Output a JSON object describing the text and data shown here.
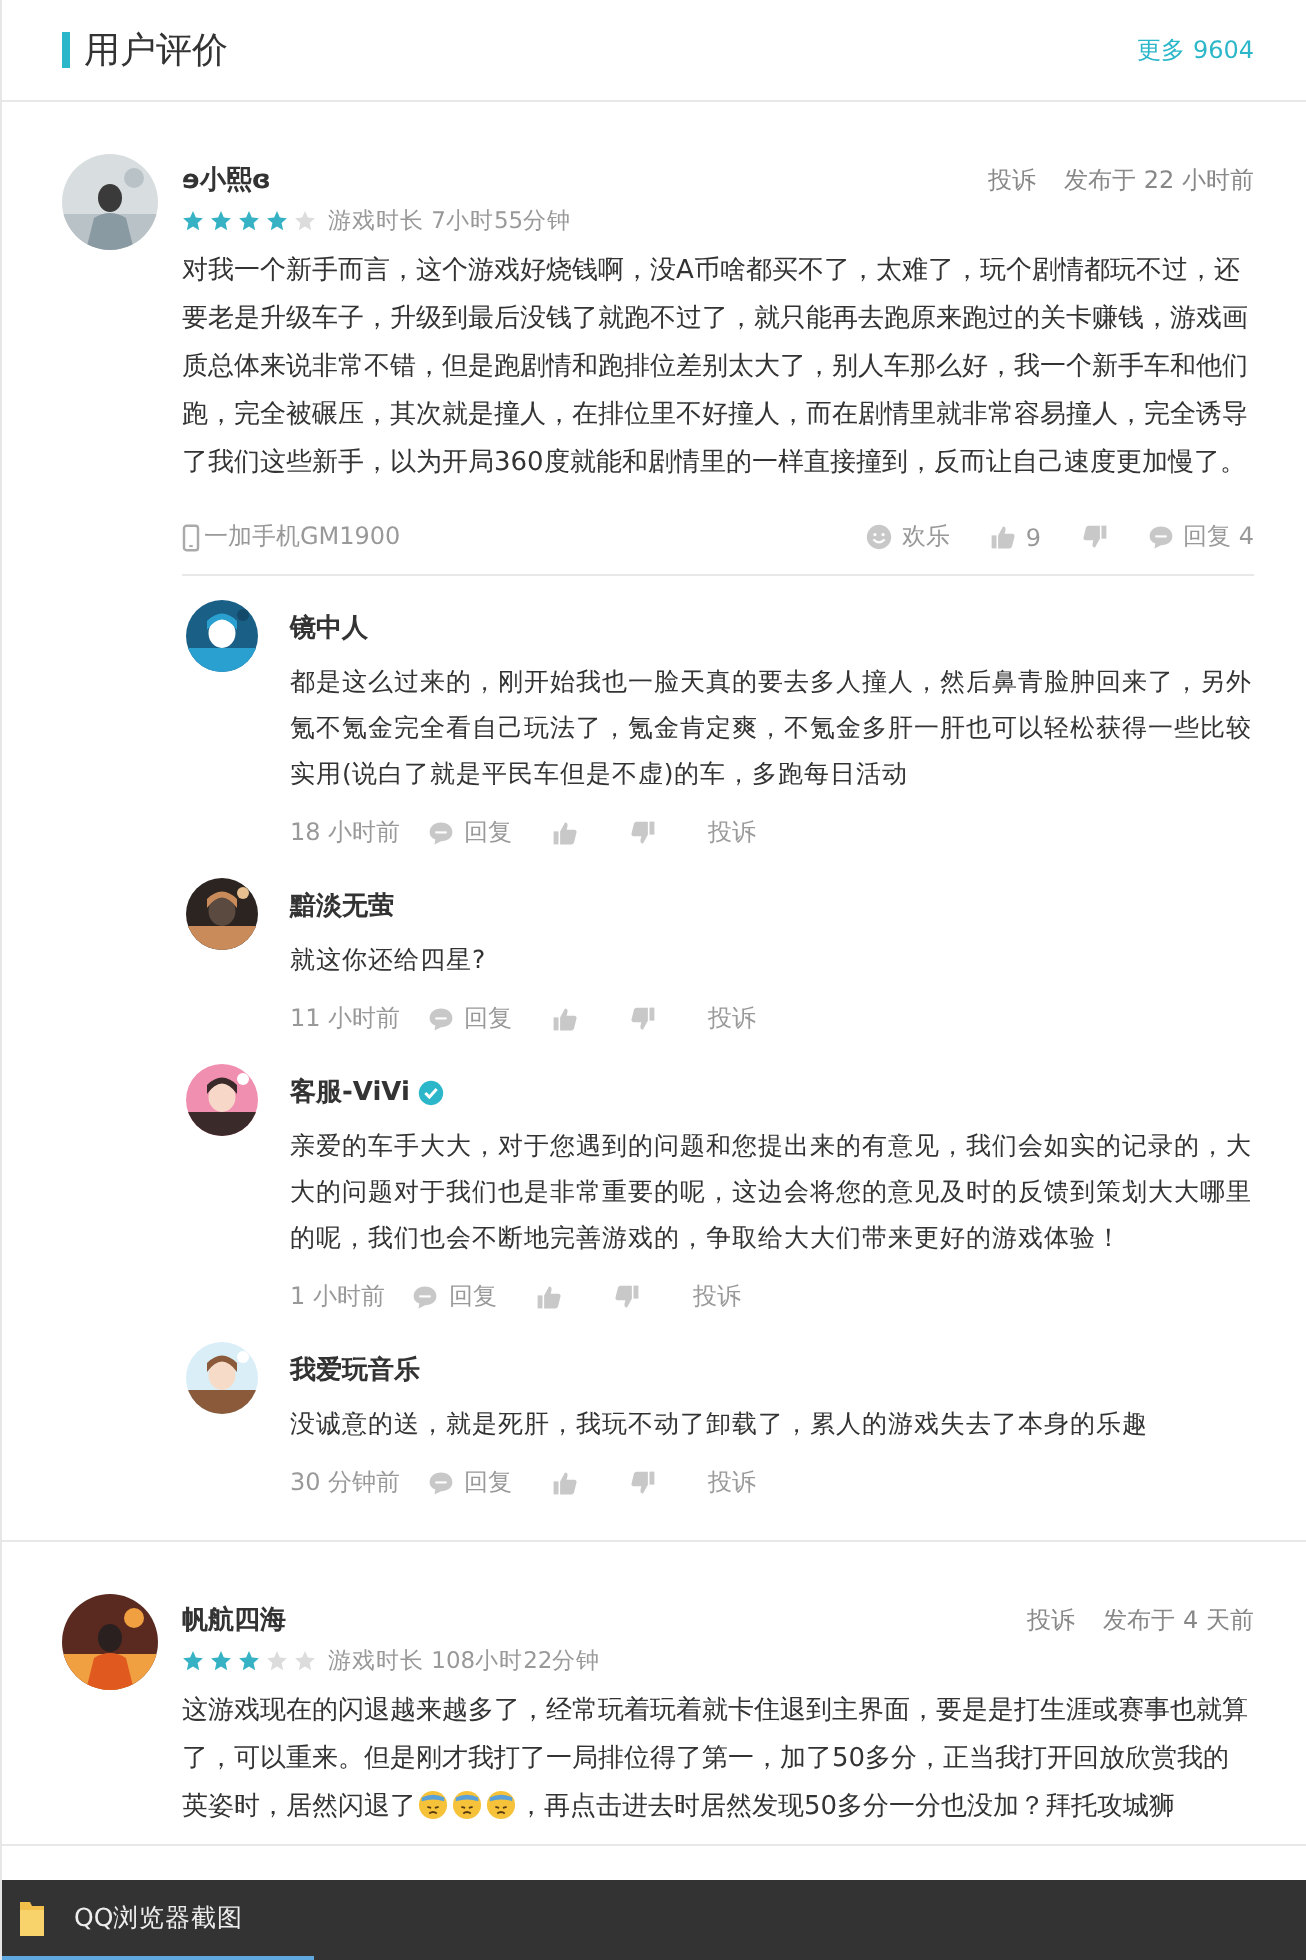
{
  "header": {
    "title": "用户评价",
    "more": "更多 9604"
  },
  "reviews": [
    {
      "name": "ɘ小熙ɞ",
      "stars": 4,
      "playtime": "游戏时长 7小时55分钟",
      "report": "投诉",
      "posted": "发布于 22 小时前",
      "body": [
        {
          "kind": "text",
          "text": "对我一个新手而言，这个游戏好烧钱啊，没A币啥都买不了，太难了，玩个剧情都玩不过，还要老是升级车子，升级到最后没钱了就跑不过了，就只能再去跑原来跑过的关卡赚钱，游戏画质总体来说非常不错，但是跑剧情和跑排位差别太大了，别人车那么好，我一个新手车和他们跑，完全被碾压，其次就是撞人，在排位里不好撞人，而在剧情里就非常容易撞人，完全诱导了我们这些新手，以为开局360度就能和剧情里的一样直接撞到，反而让自己速度更加慢了。"
        }
      ],
      "device": "一加手机GM1900",
      "mood": "欢乐",
      "likes": "9",
      "replies_label": "回复 4",
      "replies": [
        {
          "name": "镜中人",
          "verified": false,
          "text": "都是这么过来的，刚开始我也一脸天真的要去多人撞人，然后鼻青脸肿回来了，另外氪不氪金完全看自己玩法了，氪金肯定爽，不氪金多肝一肝也可以轻松获得一些比较实用(说白了就是平民车但是不虚)的车，多跑每日活动",
          "time": "18 小时前",
          "reply": "回复",
          "report": "投诉"
        },
        {
          "name": "黯淡无萤",
          "verified": false,
          "text": "就这你还给四星?",
          "time": "11 小时前",
          "reply": "回复",
          "report": "投诉"
        },
        {
          "name": "客服-ViVi",
          "verified": true,
          "text": "亲爱的车手大大，对于您遇到的问题和您提出来的有意见，我们会如实的记录的，大大的问题对于我们也是非常重要的呢，这边会将您的意见及时的反馈到策划大大哪里的呢，我们也会不断地完善游戏的，争取给大大们带来更好的游戏体验！",
          "time": "1 小时前",
          "reply": "回复",
          "report": "投诉"
        },
        {
          "name": "我爱玩音乐",
          "verified": false,
          "text": "没诚意的送，就是死肝，我玩不动了卸载了，累人的游戏失去了本身的乐趣",
          "time": "30 分钟前",
          "reply": "回复",
          "report": "投诉"
        }
      ]
    },
    {
      "name": "帆航四海",
      "stars": 3,
      "playtime": "游戏时长 108小时22分钟",
      "report": "投诉",
      "posted": "发布于 4 天前",
      "body": [
        {
          "kind": "text",
          "text": "这游戏现在的闪退越来越多了，经常玩着玩着就卡住退到主界面，要是是打生涯或赛事也就算了，可以重来。但是刚才我打了一局排位得了第一，加了50多分，正当我打开回放欣赏我的英姿时，居然闪退了"
        },
        {
          "kind": "emoji"
        },
        {
          "kind": "emoji"
        },
        {
          "kind": "emoji"
        },
        {
          "kind": "text",
          "text": "，再点击进去时居然发现50多分一分也没加？拜托攻城狮"
        }
      ]
    }
  ],
  "taskbar": {
    "label": "QQ浏览器截图"
  }
}
